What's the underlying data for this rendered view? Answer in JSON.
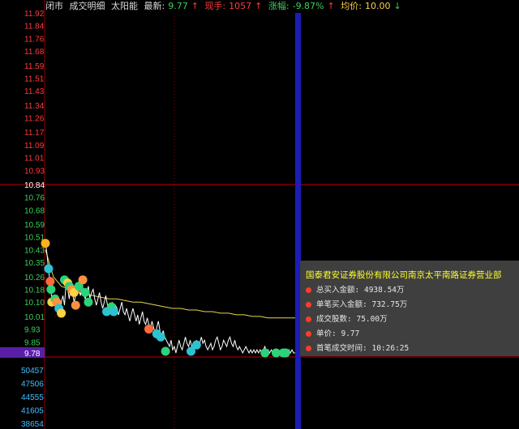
{
  "header": {
    "status": "闭市",
    "tab_detail": "成交明细",
    "tab_sun": "太阳能",
    "latest_label": "最新:",
    "latest_value": "9.77",
    "latest_arrow": "↑",
    "volume_label": "现手:",
    "volume_value": "1057",
    "volume_arrow": "↑",
    "change_label": "涨幅:",
    "change_value": "-9.87%",
    "change_arrow": "↑",
    "avg_label": "均价:",
    "avg_value": "10.00",
    "avg_arrow": "↓"
  },
  "colors": {
    "up": "#ff3b3b",
    "down": "#3bd15a",
    "neutral": "#ffffff",
    "avg_line": "#e6d64a",
    "grid_red": "#8b0000",
    "cursor": "#1c1cb8",
    "volume_axis": "#3fc0ff",
    "current_price_bg": "#5a1fa8"
  },
  "price_axis": {
    "labels": [
      "11.92",
      "11.84",
      "11.76",
      "11.68",
      "11.59",
      "11.51",
      "11.43",
      "11.34",
      "11.26",
      "11.17",
      "11.09",
      "11.01",
      "10.93",
      "10.84",
      "10.76",
      "10.68",
      "10.59",
      "10.51",
      "10.43",
      "10.35",
      "10.26",
      "10.18",
      "10.10",
      "10.01",
      "9.93",
      "9.85",
      "9.78"
    ],
    "prev_close": "10.84",
    "current": "9.78"
  },
  "volume_axis": {
    "labels": [
      "50457",
      "47506",
      "44555",
      "41605",
      "38654"
    ]
  },
  "chart_data": {
    "type": "line",
    "title": "",
    "xlabel": "",
    "ylabel": "",
    "ylim": [
      9.78,
      11.92
    ],
    "prev_close": 10.84,
    "price_series": [
      [
        0,
        10.48
      ],
      [
        2,
        10.4
      ],
      [
        4,
        10.3
      ],
      [
        6,
        10.22
      ],
      [
        8,
        10.12
      ],
      [
        10,
        10.08
      ],
      [
        12,
        10.14
      ],
      [
        14,
        10.1
      ],
      [
        16,
        10.06
      ],
      [
        18,
        10.02
      ],
      [
        20,
        10.1
      ],
      [
        22,
        10.14
      ],
      [
        24,
        10.08
      ],
      [
        26,
        10.22
      ],
      [
        28,
        10.18
      ],
      [
        30,
        10.12
      ],
      [
        32,
        10.2
      ],
      [
        34,
        10.16
      ],
      [
        36,
        10.1
      ],
      [
        38,
        10.14
      ],
      [
        40,
        10.22
      ],
      [
        42,
        10.18
      ],
      [
        44,
        10.14
      ],
      [
        46,
        10.22
      ],
      [
        48,
        10.16
      ],
      [
        50,
        10.12
      ],
      [
        52,
        10.16
      ],
      [
        54,
        10.2
      ],
      [
        56,
        10.12
      ],
      [
        58,
        10.16
      ],
      [
        60,
        10.18
      ],
      [
        62,
        10.12
      ],
      [
        64,
        10.08
      ],
      [
        66,
        10.12
      ],
      [
        68,
        10.16
      ],
      [
        70,
        10.1
      ],
      [
        72,
        10.06
      ],
      [
        74,
        10.1
      ],
      [
        76,
        10.14
      ],
      [
        78,
        10.08
      ],
      [
        80,
        10.02
      ],
      [
        82,
        10.06
      ],
      [
        84,
        10.1
      ],
      [
        86,
        10.04
      ],
      [
        88,
        10.08
      ],
      [
        90,
        10.06
      ],
      [
        92,
        10.02
      ],
      [
        94,
        10.06
      ],
      [
        96,
        10.1
      ],
      [
        98,
        10.04
      ],
      [
        100,
        10.02
      ],
      [
        102,
        10.06
      ],
      [
        104,
        10.02
      ],
      [
        106,
        9.98
      ],
      [
        108,
        10.02
      ],
      [
        110,
        10.06
      ],
      [
        112,
        10.02
      ],
      [
        114,
        9.98
      ],
      [
        116,
        10.02
      ],
      [
        118,
        9.96
      ],
      [
        120,
        10.0
      ],
      [
        122,
        10.04
      ],
      [
        124,
        9.98
      ],
      [
        126,
        9.96
      ],
      [
        128,
        10.0
      ],
      [
        130,
        9.96
      ],
      [
        132,
        9.93
      ],
      [
        134,
        9.98
      ],
      [
        136,
        9.94
      ],
      [
        138,
        9.9
      ],
      [
        140,
        9.94
      ],
      [
        142,
        9.98
      ],
      [
        144,
        9.92
      ],
      [
        146,
        9.88
      ],
      [
        148,
        9.92
      ],
      [
        150,
        9.88
      ],
      [
        152,
        9.86
      ],
      [
        154,
        9.84
      ],
      [
        156,
        9.82
      ],
      [
        158,
        9.86
      ],
      [
        160,
        9.8
      ],
      [
        162,
        9.82
      ],
      [
        164,
        9.78
      ],
      [
        166,
        9.82
      ],
      [
        168,
        9.86
      ],
      [
        170,
        9.82
      ],
      [
        172,
        9.8
      ],
      [
        174,
        9.84
      ],
      [
        176,
        9.88
      ],
      [
        178,
        9.84
      ],
      [
        180,
        9.82
      ],
      [
        182,
        9.86
      ],
      [
        184,
        9.82
      ],
      [
        186,
        9.8
      ],
      [
        188,
        9.82
      ],
      [
        190,
        9.86
      ],
      [
        192,
        9.82
      ],
      [
        194,
        9.84
      ],
      [
        196,
        9.88
      ],
      [
        198,
        9.84
      ],
      [
        200,
        9.86
      ],
      [
        202,
        9.82
      ],
      [
        204,
        9.8
      ],
      [
        206,
        9.82
      ],
      [
        208,
        9.84
      ],
      [
        210,
        9.8
      ],
      [
        212,
        9.82
      ],
      [
        214,
        9.86
      ],
      [
        216,
        9.88
      ],
      [
        218,
        9.84
      ],
      [
        220,
        9.8
      ],
      [
        222,
        9.82
      ],
      [
        224,
        9.86
      ],
      [
        226,
        9.84
      ],
      [
        228,
        9.82
      ],
      [
        230,
        9.86
      ],
      [
        232,
        9.88
      ],
      [
        234,
        9.84
      ],
      [
        236,
        9.82
      ],
      [
        238,
        9.86
      ],
      [
        240,
        9.82
      ],
      [
        242,
        9.8
      ],
      [
        244,
        9.82
      ],
      [
        246,
        9.8
      ],
      [
        248,
        9.78
      ],
      [
        250,
        9.8
      ],
      [
        252,
        9.82
      ],
      [
        254,
        9.8
      ],
      [
        256,
        9.78
      ],
      [
        258,
        9.8
      ],
      [
        260,
        9.78
      ],
      [
        262,
        9.8
      ],
      [
        264,
        9.78
      ],
      [
        266,
        9.8
      ],
      [
        268,
        9.78
      ],
      [
        270,
        9.8
      ],
      [
        272,
        9.78
      ],
      [
        274,
        9.8
      ],
      [
        276,
        9.82
      ],
      [
        278,
        9.78
      ],
      [
        280,
        9.8
      ],
      [
        282,
        9.78
      ],
      [
        284,
        9.8
      ],
      [
        286,
        9.78
      ],
      [
        288,
        9.8
      ],
      [
        290,
        9.78
      ],
      [
        292,
        9.8
      ],
      [
        294,
        9.78
      ],
      [
        296,
        9.8
      ],
      [
        298,
        9.8
      ],
      [
        300,
        9.78
      ],
      [
        302,
        9.8
      ],
      [
        304,
        9.78
      ],
      [
        306,
        9.8
      ],
      [
        308,
        9.78
      ],
      [
        310,
        9.8
      ],
      [
        312,
        9.78
      ],
      [
        314,
        9.78
      ]
    ],
    "avg_series": [
      [
        0,
        10.43
      ],
      [
        10,
        10.26
      ],
      [
        20,
        10.2
      ],
      [
        30,
        10.18
      ],
      [
        40,
        10.16
      ],
      [
        50,
        10.15
      ],
      [
        60,
        10.14
      ],
      [
        70,
        10.13
      ],
      [
        80,
        10.12
      ],
      [
        90,
        10.12
      ],
      [
        100,
        10.11
      ],
      [
        110,
        10.1
      ],
      [
        120,
        10.1
      ],
      [
        130,
        10.09
      ],
      [
        140,
        10.08
      ],
      [
        150,
        10.07
      ],
      [
        160,
        10.06
      ],
      [
        170,
        10.06
      ],
      [
        180,
        10.05
      ],
      [
        190,
        10.05
      ],
      [
        200,
        10.04
      ],
      [
        210,
        10.04
      ],
      [
        220,
        10.03
      ],
      [
        230,
        10.03
      ],
      [
        240,
        10.02
      ],
      [
        250,
        10.02
      ],
      [
        260,
        10.01
      ],
      [
        270,
        10.01
      ],
      [
        280,
        10.0
      ],
      [
        290,
        10.0
      ],
      [
        300,
        10.0
      ],
      [
        314,
        10.0
      ]
    ],
    "bubbles": [
      {
        "t": 0,
        "p": 10.47,
        "c": "#ffb020"
      },
      {
        "t": 4,
        "p": 10.31,
        "c": "#2bc3d4"
      },
      {
        "t": 6,
        "p": 10.23,
        "c": "#ff6a3c"
      },
      {
        "t": 7,
        "p": 10.18,
        "c": "#2bd37a"
      },
      {
        "t": 8,
        "p": 10.1,
        "c": "#ffd040"
      },
      {
        "t": 12,
        "p": 10.12,
        "c": "#2bd37a"
      },
      {
        "t": 14,
        "p": 10.1,
        "c": "#ff9040"
      },
      {
        "t": 17,
        "p": 10.06,
        "c": "#2bc3d4"
      },
      {
        "t": 20,
        "p": 10.03,
        "c": "#ffd040"
      },
      {
        "t": 24,
        "p": 10.24,
        "c": "#2bd37a"
      },
      {
        "t": 28,
        "p": 10.22,
        "c": "#ffd040"
      },
      {
        "t": 30,
        "p": 10.2,
        "c": "#2bd37a"
      },
      {
        "t": 33,
        "p": 10.18,
        "c": "#ff9040"
      },
      {
        "t": 36,
        "p": 10.16,
        "c": "#ffd040"
      },
      {
        "t": 38,
        "p": 10.08,
        "c": "#ff9040"
      },
      {
        "t": 42,
        "p": 10.2,
        "c": "#2bd37a"
      },
      {
        "t": 47,
        "p": 10.24,
        "c": "#ff9040"
      },
      {
        "t": 50,
        "p": 10.16,
        "c": "#2bd37a"
      },
      {
        "t": 54,
        "p": 10.1,
        "c": "#2bd37a"
      },
      {
        "t": 77,
        "p": 10.04,
        "c": "#2bc3d4"
      },
      {
        "t": 83,
        "p": 10.07,
        "c": "#2bd37a"
      },
      {
        "t": 86,
        "p": 10.04,
        "c": "#2bc3d4"
      },
      {
        "t": 130,
        "p": 9.93,
        "c": "#ff6a3c"
      },
      {
        "t": 140,
        "p": 9.9,
        "c": "#2bc3d4"
      },
      {
        "t": 145,
        "p": 9.88,
        "c": "#2bc3d4"
      },
      {
        "t": 151,
        "p": 9.79,
        "c": "#2bd37a"
      },
      {
        "t": 183,
        "p": 9.79,
        "c": "#2bc3d4"
      },
      {
        "t": 190,
        "p": 9.83,
        "c": "#2bc3d4"
      },
      {
        "t": 276,
        "p": 9.78,
        "c": "#2bd37a"
      },
      {
        "t": 290,
        "p": 9.78,
        "c": "#2bd37a"
      },
      {
        "t": 299,
        "p": 9.78,
        "c": "#2bd37a"
      },
      {
        "t": 302,
        "p": 9.78,
        "c": "#2bd37a"
      }
    ]
  },
  "popup": {
    "title": "国泰君安证券股份有限公司南京太平南路证券营业部",
    "rows": [
      {
        "label": "总买入金额:",
        "value": "4938.54万"
      },
      {
        "label": "单笔买入金额:",
        "value": "732.75万"
      },
      {
        "label": "成交股数:",
        "value": "75.00万"
      },
      {
        "label": "单价:",
        "value": "9.77"
      },
      {
        "label": "首笔成交时间:",
        "value": "10:26:25"
      }
    ]
  }
}
